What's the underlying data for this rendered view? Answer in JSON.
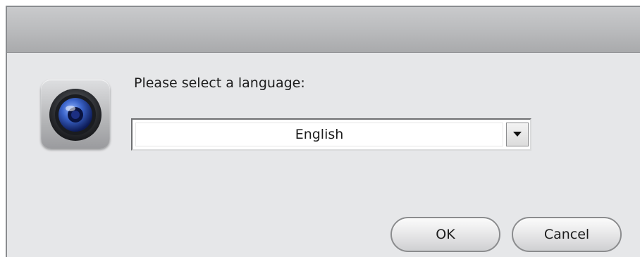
{
  "dialog": {
    "title": "",
    "prompt_label": "Please select a language:",
    "icon": "camera-lens-icon"
  },
  "language_select": {
    "selected_value": "English",
    "arrow_icon": "chevron-down-icon"
  },
  "buttons": {
    "ok_label": "OK",
    "cancel_label": "Cancel"
  },
  "colors": {
    "background": "#e6e7e9",
    "titlebar": "#bcbdbf",
    "lens_blue": "#3a63c8"
  }
}
